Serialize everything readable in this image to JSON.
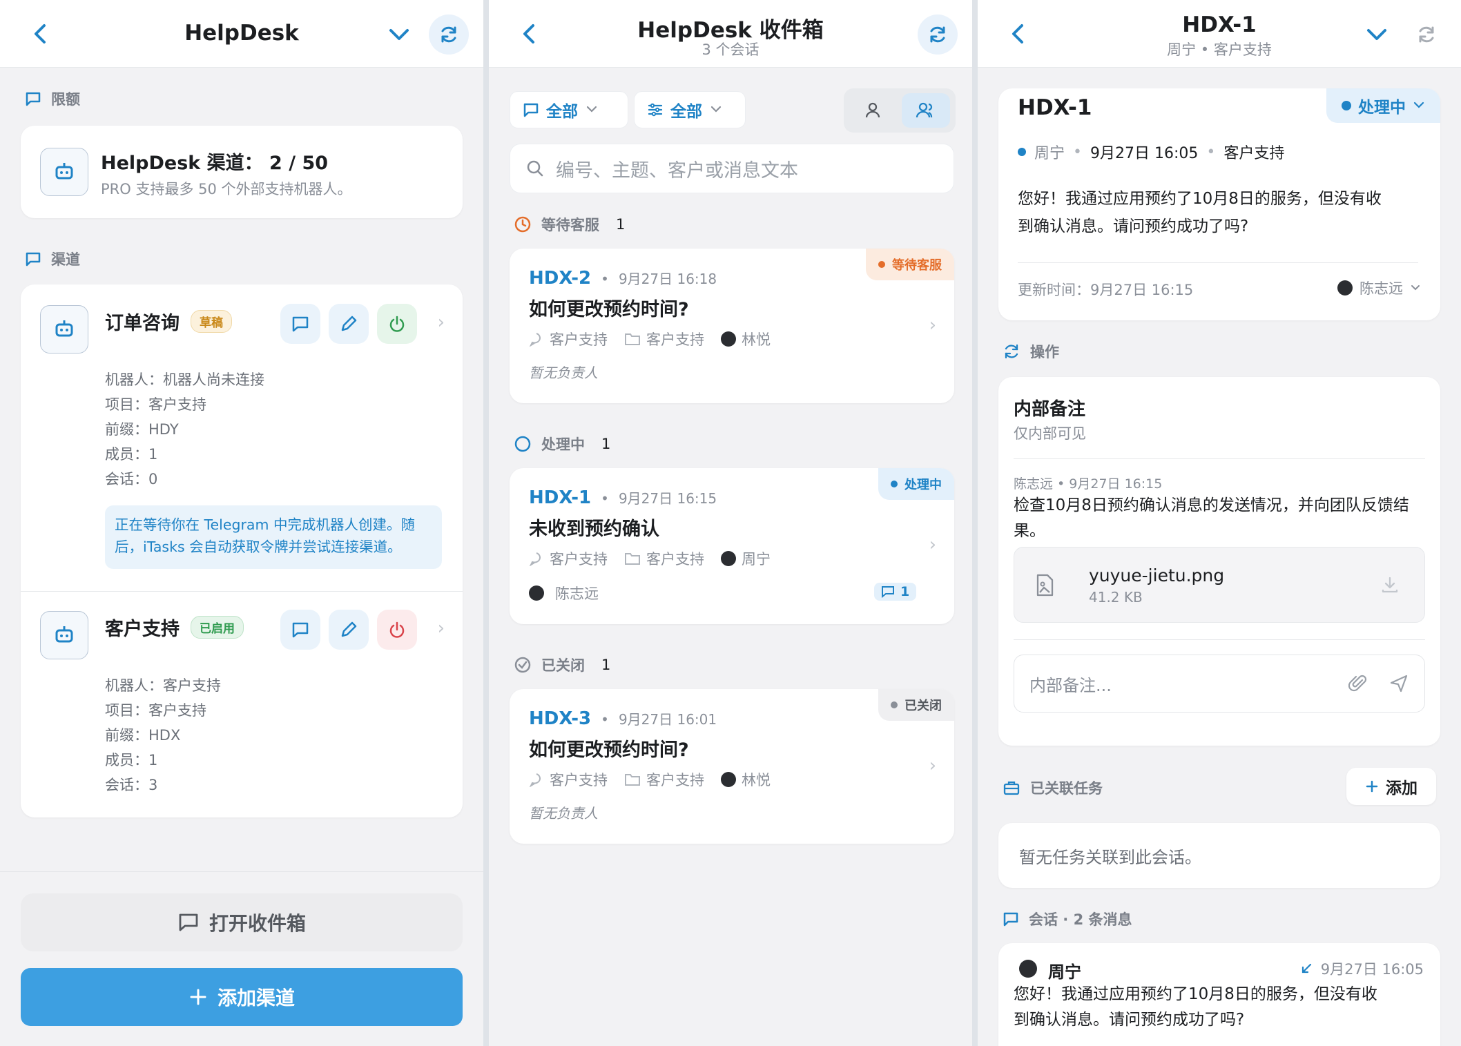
{
  "panel1": {
    "title": "HelpDesk",
    "quota_section": "限额",
    "quota_title": "HelpDesk 渠道： 2 / 50",
    "quota_desc": "PRO 支持最多 50 个外部支持机器人。",
    "channels_section": "渠道",
    "channels": [
      {
        "name": "订单咨询",
        "badge": "草稿",
        "lines": [
          "机器人：机器人尚未连接",
          "项目：客户支持",
          "前缀：HDY",
          "成员：1",
          "会话：0"
        ],
        "notice": "正在等待你在 Telegram 中完成机器人创建。随后，iTasks 会自动获取令牌并尝试连接渠道。"
      },
      {
        "name": "客户支持",
        "badge": "已启用",
        "lines": [
          "机器人：客户支持",
          "项目：客户支持",
          "前缀：HDX",
          "成员：1",
          "会话：3"
        ]
      }
    ],
    "open_inbox": "打开收件箱",
    "add_channel": "添加渠道"
  },
  "panel2": {
    "title": "HelpDesk 收件箱",
    "subtitle": "3 个会话",
    "filter1": "全部",
    "filter2": "全部",
    "search_placeholder": "编号、主题、客户或消息文本",
    "groups": [
      {
        "label": "等待客服",
        "count": "1"
      },
      {
        "label": "处理中",
        "count": "1"
      },
      {
        "label": "已关闭",
        "count": "1"
      }
    ],
    "tickets": [
      {
        "id": "HDX-2",
        "date": "9月27日 16:18",
        "title": "如何更改预约时间?",
        "status": "等待客服",
        "channel": "客户支持",
        "project": "客户支持",
        "customer": "林悦",
        "assignee": "暂无负责人"
      },
      {
        "id": "HDX-1",
        "date": "9月27日 16:15",
        "title": "未收到预约确认",
        "status": "处理中",
        "channel": "客户支持",
        "project": "客户支持",
        "customer": "周宁",
        "assignee": "陈志远",
        "messages": "1"
      },
      {
        "id": "HDX-3",
        "date": "9月27日 16:01",
        "title": "如何更改预约时间?",
        "status": "已关闭",
        "channel": "客户支持",
        "project": "客户支持",
        "customer": "林悦",
        "assignee": "暂无负责人"
      }
    ]
  },
  "panel3": {
    "title": "HDX-1",
    "subtitle": "周宁 • 客户支持",
    "ticket_id": "HDX-1",
    "status": "处理中",
    "customer": "周宁",
    "date": "9月27日 16:05",
    "project": "客户支持",
    "message_line1": "您好！我通过应用预约了10月8日的服务，但没有收",
    "message_line2": "到确认消息。请问预约成功了吗?",
    "updated": "更新时间：9月27日 16:15",
    "assignee": "陈志远",
    "actions_section": "操作",
    "note_title": "内部备注",
    "note_sub": "仅内部可见",
    "note_author": "陈志远 • 9月27日 16:15",
    "note_line1": "检查10月8日预约确认消息的发送情况，并向团队反馈结",
    "note_line2": "果。",
    "file_name": "yuyue-jietu.png",
    "file_size": "41.2 KB",
    "note_placeholder": "内部备注...",
    "linked_section": "已关联任务",
    "add_label": "添加",
    "no_tasks": "暂无任务关联到此会话。",
    "conv_section": "会话 · 2 条消息",
    "msg_author": "周宁",
    "msg_time": "9月27日 16:05",
    "msg_line1": "您好！我通过应用预约了10月8日的服务，但没有收",
    "msg_line2": "到确认消息。请问预约成功了吗?"
  },
  "colors": {
    "accent": "#1f83c6",
    "primary_button": "#3d9fe1",
    "waiting": "#e46d2a",
    "processing": "#1f83c6",
    "closed": "#8a8f98",
    "draft_badge": "#c9891a",
    "enabled_badge": "#2f9b4f",
    "danger": "#d9434a",
    "success": "#2f9b4f"
  }
}
